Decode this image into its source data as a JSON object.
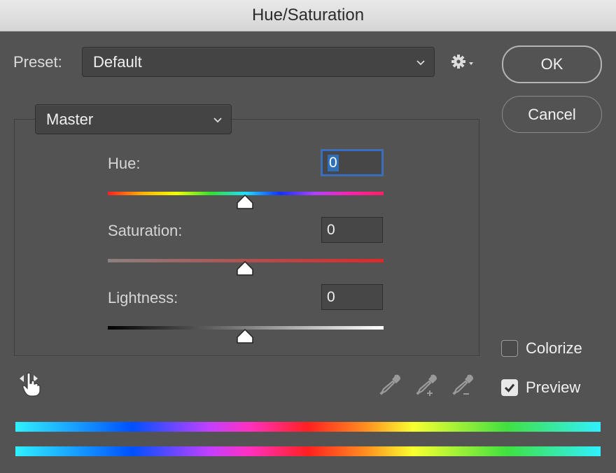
{
  "window": {
    "title": "Hue/Saturation"
  },
  "preset": {
    "label": "Preset:",
    "value": "Default"
  },
  "buttons": {
    "ok": "OK",
    "cancel": "Cancel"
  },
  "channel": {
    "value": "Master"
  },
  "hue": {
    "label": "Hue:",
    "value": "0"
  },
  "saturation": {
    "label": "Saturation:",
    "value": "0"
  },
  "lightness": {
    "label": "Lightness:",
    "value": "0"
  },
  "options": {
    "colorize": {
      "label": "Colorize",
      "checked": false
    },
    "preview": {
      "label": "Preview",
      "checked": true
    }
  },
  "icons": {
    "settings": "gear-icon",
    "targeted_adjustment": "hand-icon",
    "eyedropper": "eyedropper-icon",
    "eyedropper_add": "eyedropper-plus-icon",
    "eyedropper_subtract": "eyedropper-minus-icon"
  },
  "colors": {
    "dialog_bg": "#535353",
    "focus": "#2f6fd3"
  }
}
